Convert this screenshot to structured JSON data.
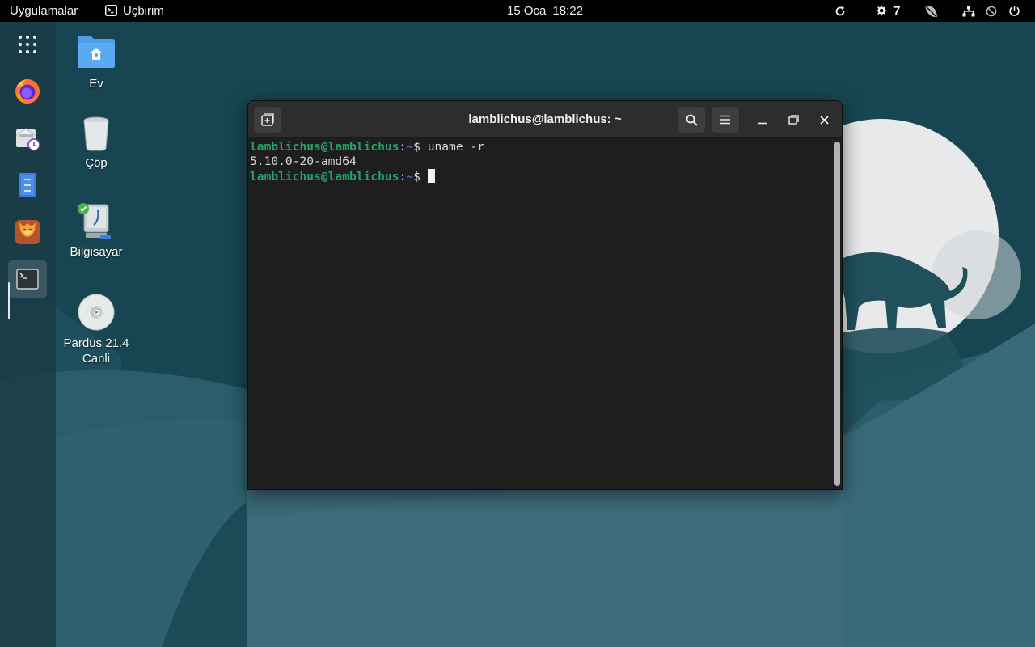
{
  "topbar": {
    "applications_label": "Uygulamalar",
    "focused_app_label": "Uçbirim",
    "date": "15 Oca",
    "time": "18:22",
    "notification_count": "7"
  },
  "dock": {
    "items": [
      {
        "name": "app-grid-icon"
      },
      {
        "name": "firefox-icon"
      },
      {
        "name": "mail-client-icon"
      },
      {
        "name": "text-editor-icon"
      },
      {
        "name": "lion-app-icon"
      },
      {
        "name": "terminal-icon",
        "active": true
      }
    ]
  },
  "desktop": {
    "icons": [
      {
        "label": "Ev"
      },
      {
        "label": "Çöp"
      },
      {
        "label": "Bilgisayar"
      },
      {
        "label": "Pardus 21.4\nCanli"
      }
    ]
  },
  "terminal": {
    "title": "lamblichus@lamblichus: ~",
    "lines": [
      {
        "prompt_user": "lamblichus@lamblichus",
        "prompt_path": "~",
        "prompt_symbol": "$",
        "command": "uname -r"
      },
      {
        "output": "5.10.0-20-amd64"
      },
      {
        "prompt_user": "lamblichus@lamblichus",
        "prompt_path": "~",
        "prompt_symbol": "$",
        "command": ""
      }
    ]
  },
  "colors": {
    "prompt_user": "#26a269",
    "prompt_path": "#3f6fb5",
    "wallpaper_dark": "#174652",
    "wallpaper_mid": "#2b5d6b",
    "wallpaper_light": "#3c6878",
    "moon": "#e7e9ea"
  }
}
